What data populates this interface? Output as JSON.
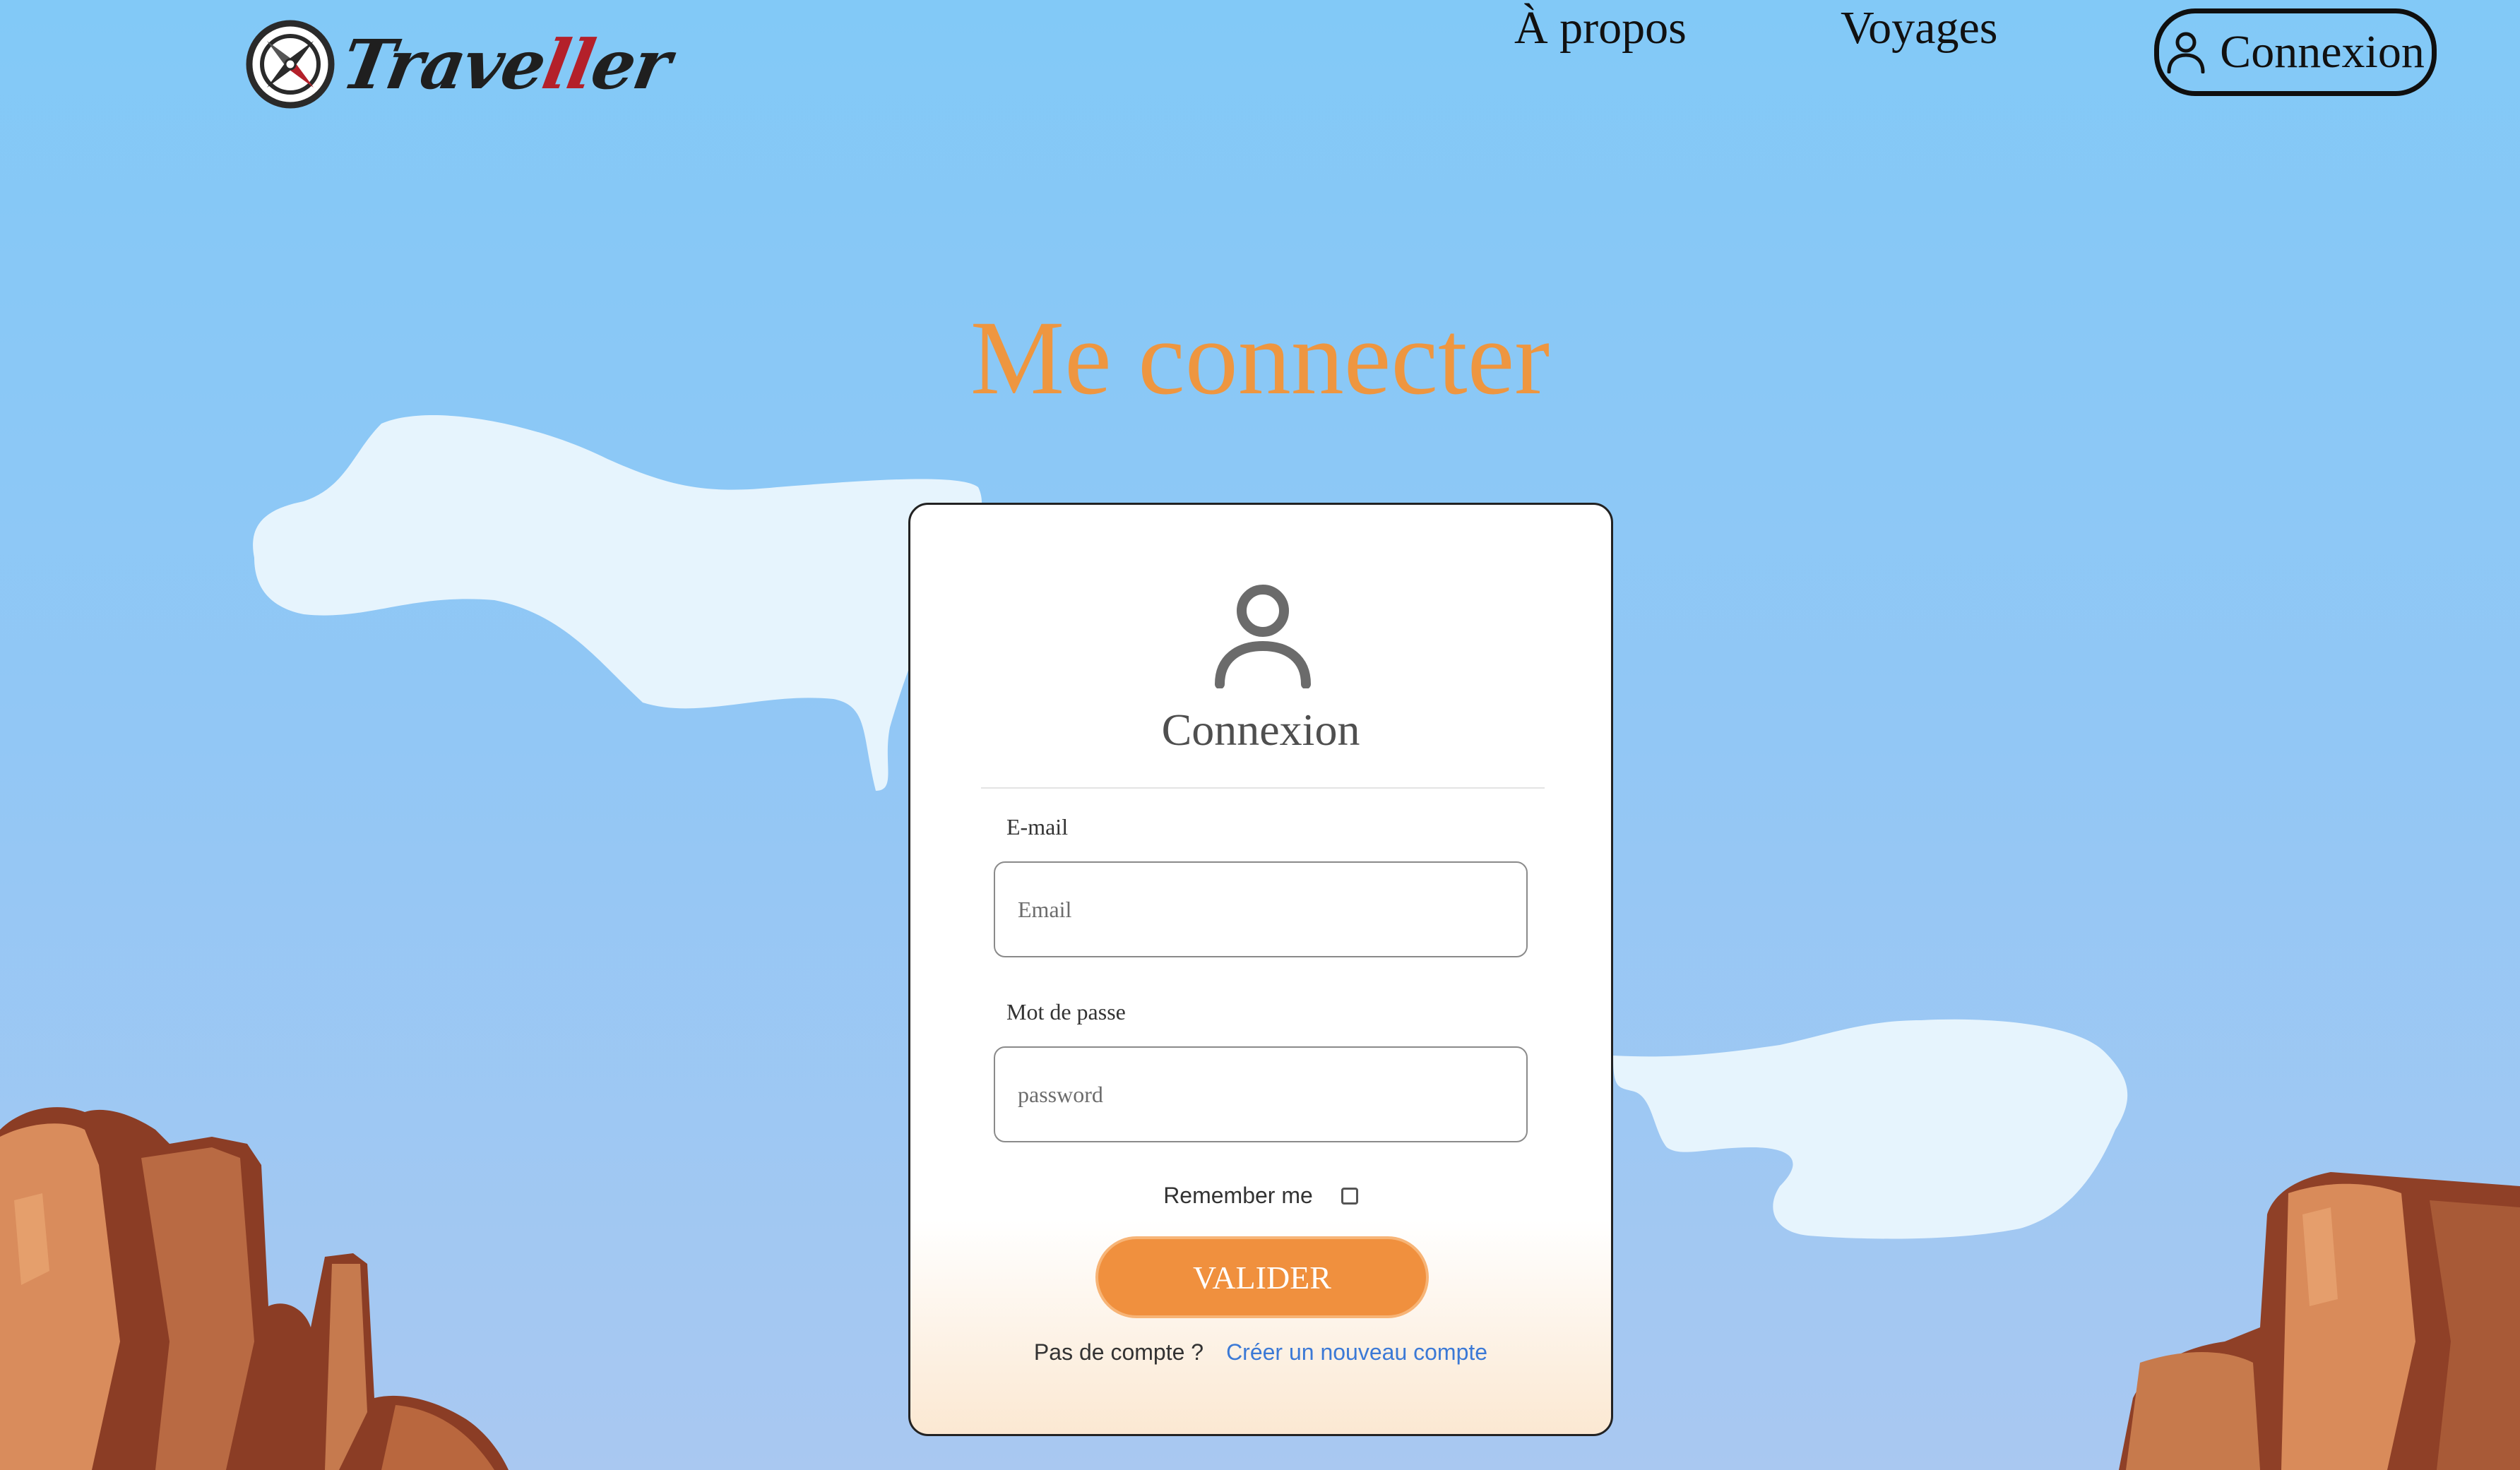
{
  "header": {
    "logo_text_main": "Trave",
    "logo_text_accent": "ll",
    "logo_text_end": "er",
    "nav": {
      "about": "À propos",
      "trips": "Voyages",
      "login": "Connexion"
    }
  },
  "page": {
    "title": "Me connecter"
  },
  "login_card": {
    "title": "Connexion",
    "email_label": "E-mail",
    "email_placeholder": "Email",
    "email_value": "",
    "password_label": "Mot de passe",
    "password_placeholder": "password",
    "password_value": "",
    "remember_label": "Remember me",
    "remember_checked": false,
    "submit_label": "VALIDER",
    "no_account_text": "Pas de compte ?",
    "signup_link": "Créer un nouveau compte"
  },
  "colors": {
    "accent": "#ee9640",
    "sky_top": "#82c9f7",
    "sky_bottom": "#a9c8f1",
    "link": "#3b79d6",
    "logo_red": "#b4202a"
  },
  "icons": {
    "logo": "compass-icon",
    "nav_login": "user-icon",
    "card_avatar": "user-avatar-icon"
  }
}
